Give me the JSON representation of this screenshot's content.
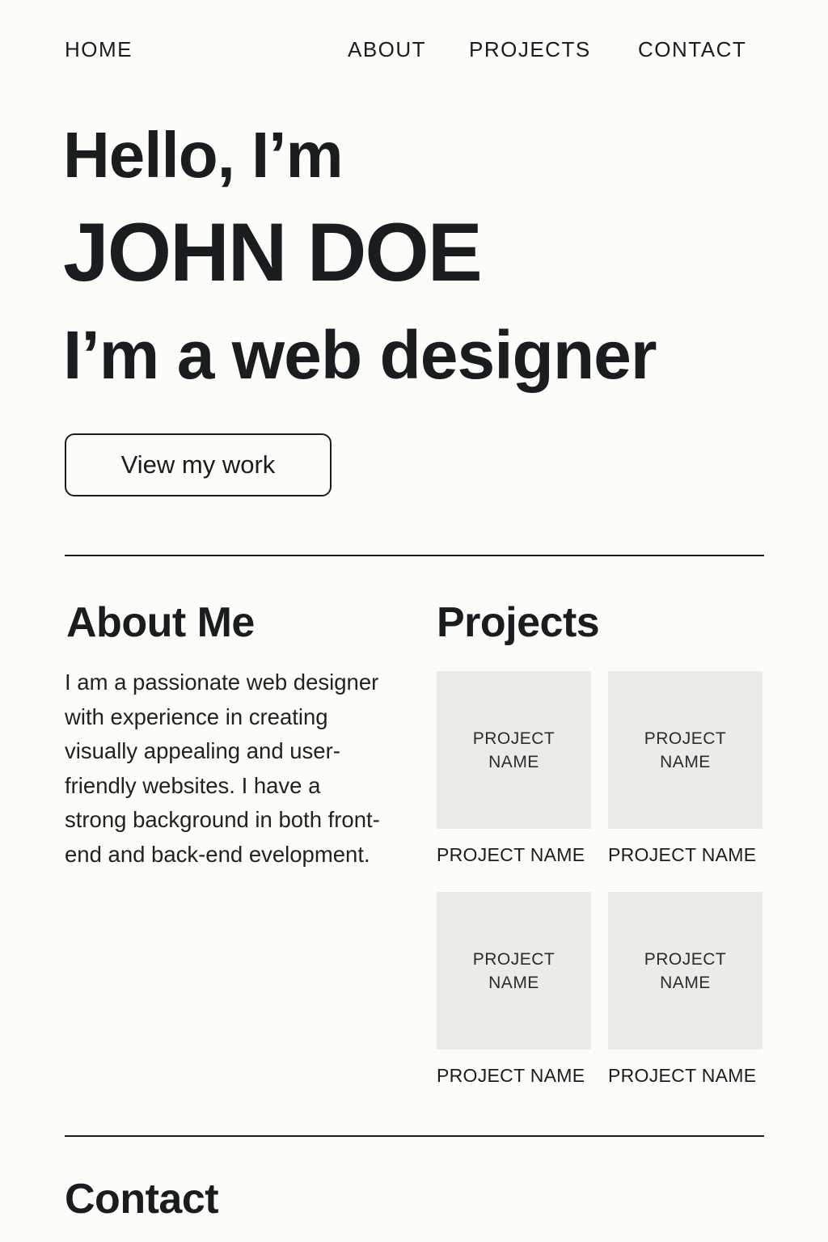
{
  "nav": {
    "home": "HOME",
    "about": "ABOUT",
    "projects": "PROJECTS",
    "contact": "CONTACT"
  },
  "hero": {
    "greeting": "Hello, I’m",
    "name": "JOHN DOE",
    "tagline": "I’m a web designer",
    "cta_label": "View my work"
  },
  "about": {
    "title": "About Me",
    "text": "I am a passionate web designer\nwith experience in creating\nvisually appealing and user-\nfriendly websites. I have a\nstrong background in both front-\nend and back-end evelopment."
  },
  "projects": {
    "title": "Projects",
    "items": [
      {
        "thumb_label": "PROJECT\nNAME",
        "caption": "PROJECT NAME"
      },
      {
        "thumb_label": "PROJECT\nNAME",
        "caption": "PROJECT NAME"
      },
      {
        "thumb_label": "PROJECT\nNAME",
        "caption": "PROJECT NAME"
      },
      {
        "thumb_label": "PROJECT\nNAME",
        "caption": "PROJECT NAME"
      }
    ]
  },
  "contact": {
    "title": "Contact"
  },
  "colors": {
    "background": "#fcfcf9",
    "text": "#1a1d1f",
    "thumb_placeholder": "#ebebe8"
  }
}
